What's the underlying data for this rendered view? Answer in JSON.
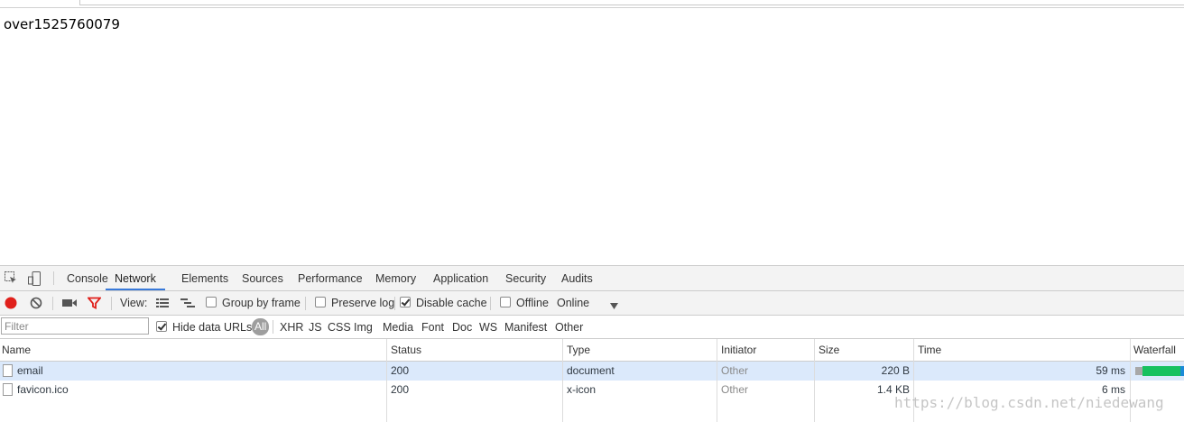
{
  "page": {
    "text": "over1525760079"
  },
  "devtools": {
    "tabs": [
      {
        "label": "Console"
      },
      {
        "label": "Network"
      },
      {
        "label": "Elements"
      },
      {
        "label": "Sources"
      },
      {
        "label": "Performance"
      },
      {
        "label": "Memory"
      },
      {
        "label": "Application"
      },
      {
        "label": "Security"
      },
      {
        "label": "Audits"
      }
    ],
    "active_tab": "Network",
    "toolbar": {
      "view_label": "View:",
      "group_by_frame": "Group by frame",
      "preserve_log": "Preserve log",
      "disable_cache": "Disable cache",
      "offline": "Offline",
      "throttle_value": "Online",
      "colors": {
        "record": "#e0201b",
        "filter_icon": "#e0201b"
      }
    },
    "filter": {
      "placeholder": "Filter",
      "hide_data_urls": "Hide data URLs",
      "types": [
        "All",
        "XHR",
        "JS",
        "CSS",
        "Img",
        "Media",
        "Font",
        "Doc",
        "WS",
        "Manifest",
        "Other"
      ]
    },
    "table": {
      "columns": [
        "Name",
        "Status",
        "Type",
        "Initiator",
        "Size",
        "Time",
        "Waterfall"
      ],
      "rows": [
        {
          "name": "email",
          "status": "200",
          "type": "document",
          "initiator": "Other",
          "size": "220 B",
          "time": "59 ms"
        },
        {
          "name": "favicon.ico",
          "status": "200",
          "type": "x-icon",
          "initiator": "Other",
          "size": "1.4 KB",
          "time": "6 ms"
        }
      ],
      "waterfall_colors": {
        "waiting": "#a8a8a8",
        "download": "#17c15f",
        "end": "#1a8ad8"
      }
    }
  },
  "watermark": "https://blog.csdn.net/niedewang"
}
